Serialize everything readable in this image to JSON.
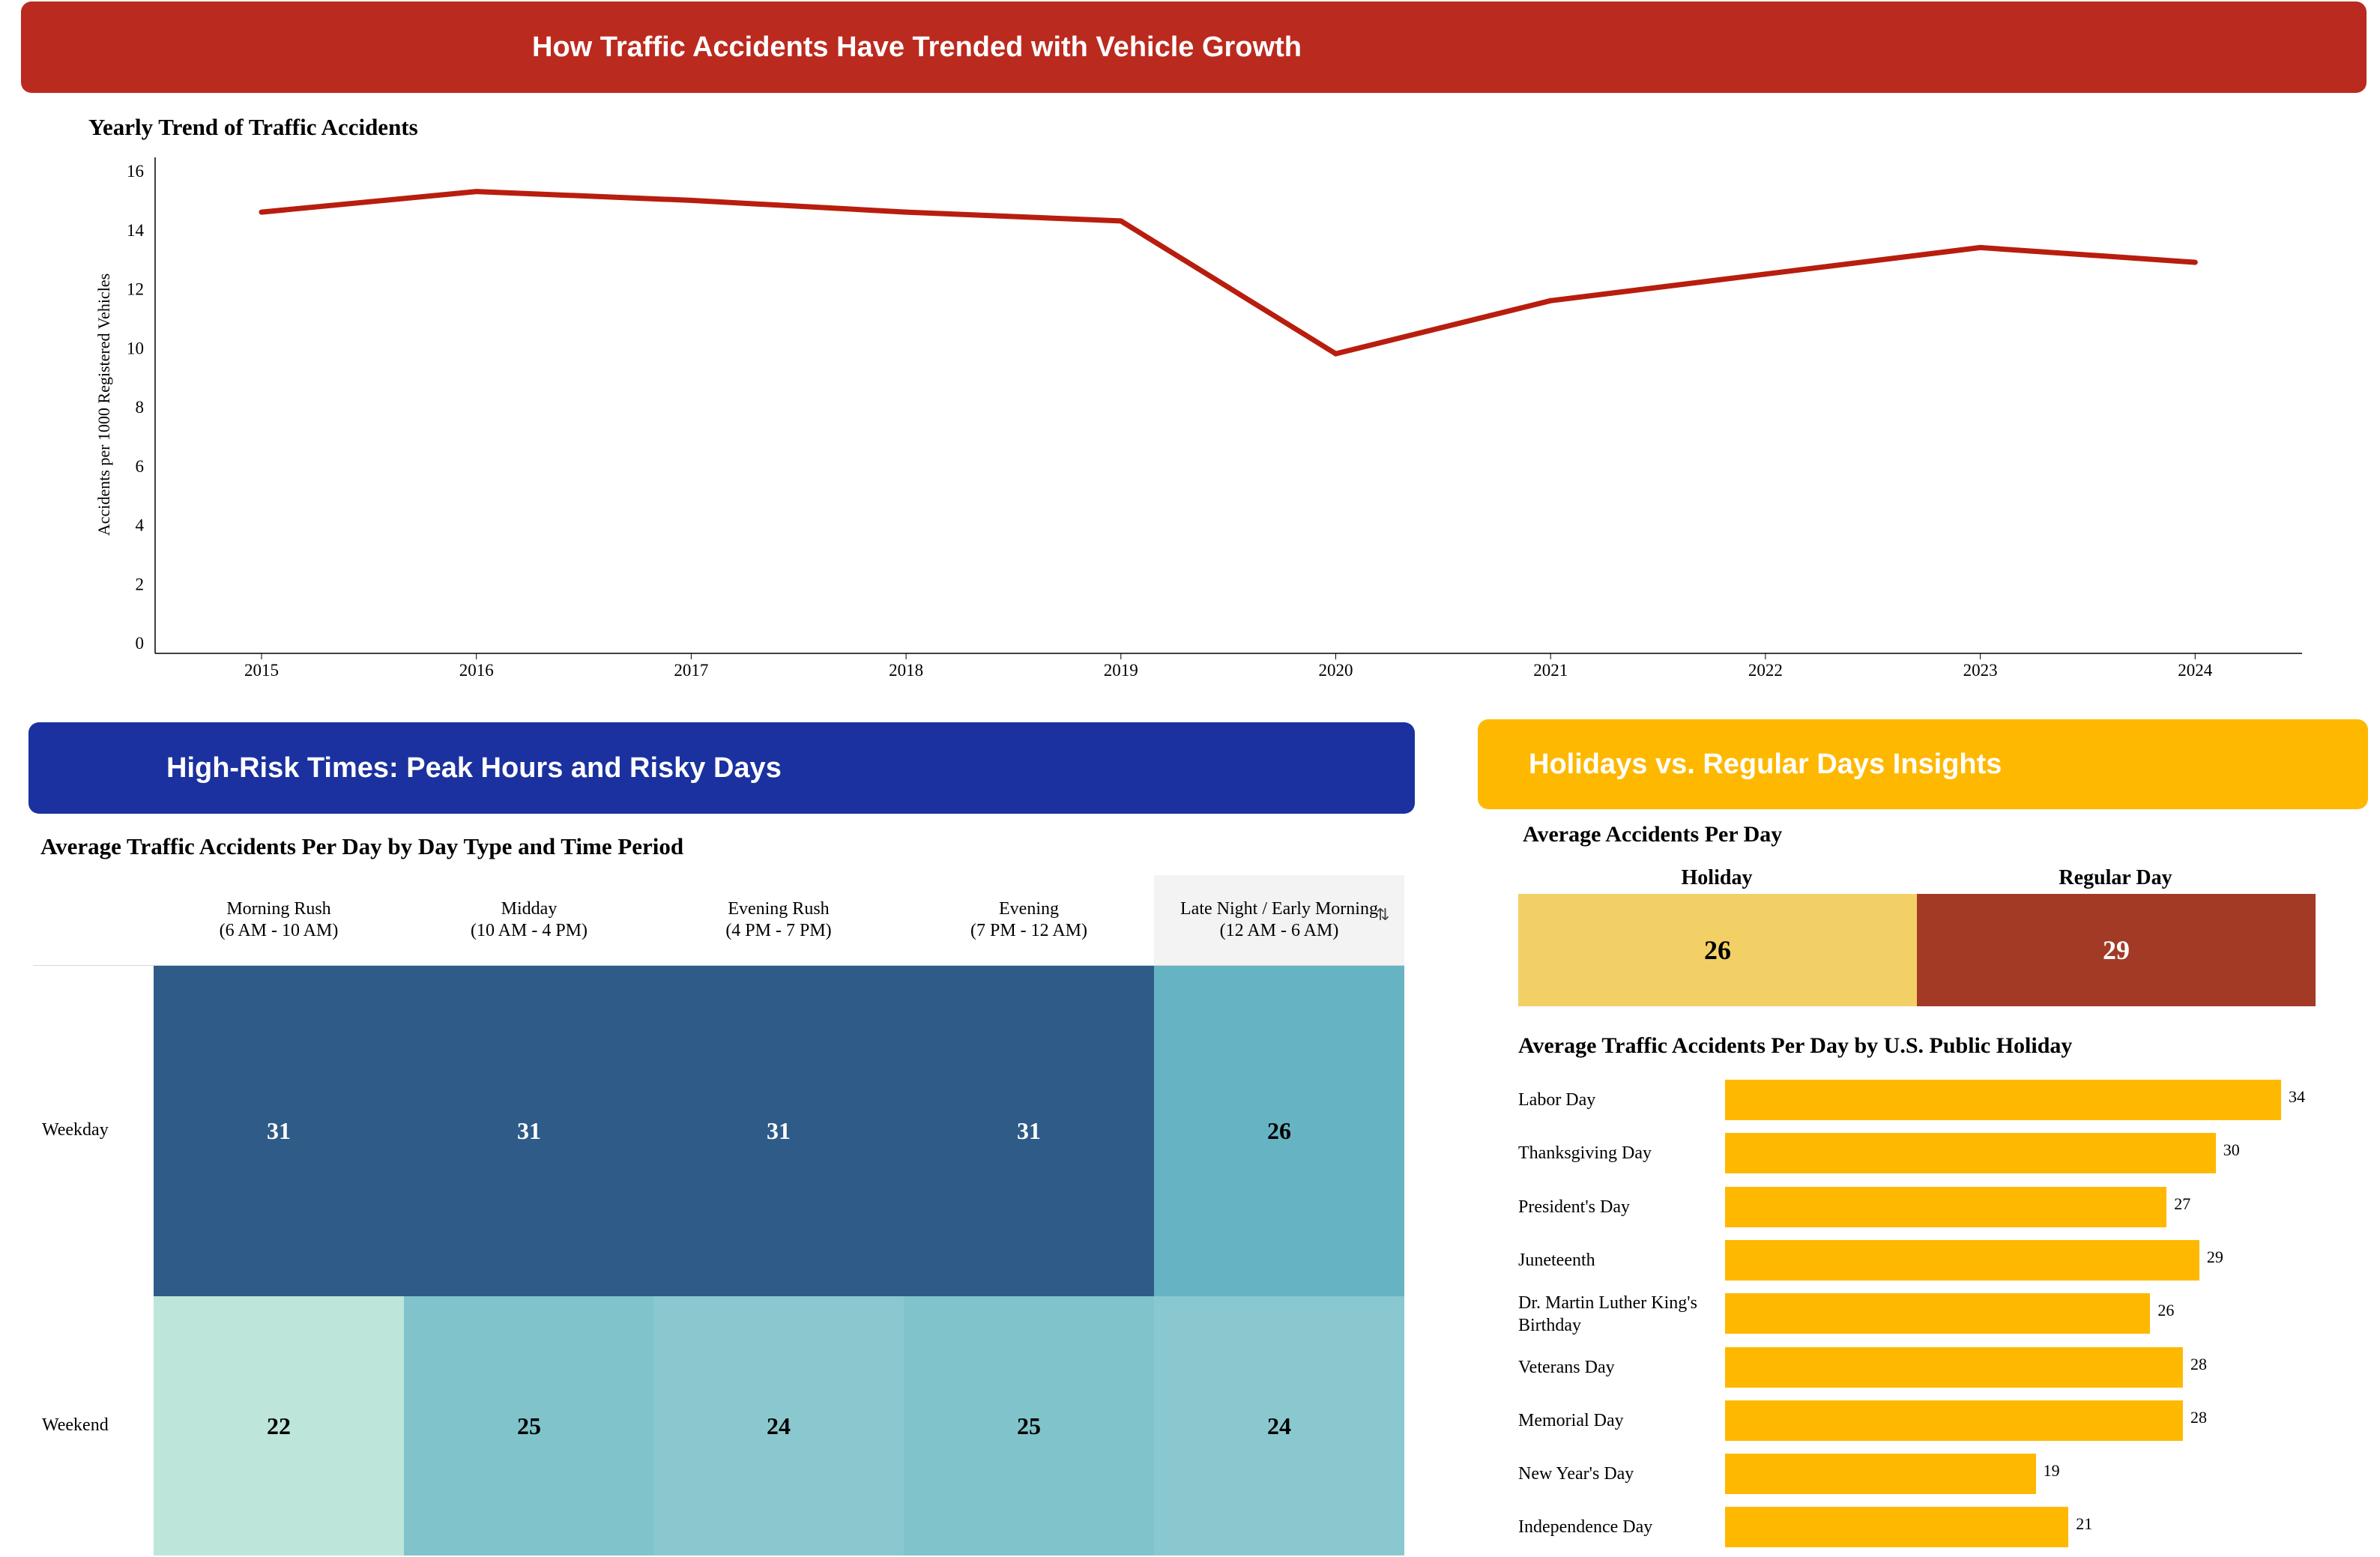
{
  "banners": {
    "top": "How Traffic Accidents Have Trended with Vehicle Growth",
    "blue": "High-Risk Times: Peak Hours and Risky Days",
    "yellow": "Holidays vs. Regular Days Insights"
  },
  "colors": {
    "red_banner": "#bb2a1f",
    "blue_banner": "#1b319f",
    "yellow_banner": "#ffb800",
    "line": "#b81d0e",
    "holiday": "#f2d066",
    "regular_day": "#a23a25",
    "bar": "#ffb800"
  },
  "chart_data": [
    {
      "type": "line",
      "title": "Yearly Trend of Traffic Accidents",
      "xlabel": "",
      "ylabel": "Accidents per 1000 Registered Vehicles",
      "x": [
        "2015",
        "2016",
        "2017",
        "2018",
        "2019",
        "2020",
        "2021",
        "2022",
        "2023",
        "2024"
      ],
      "series": [
        {
          "values": [
            14.6,
            15.3,
            15.0,
            14.6,
            14.3,
            9.8,
            11.6,
            12.5,
            13.4,
            12.9
          ]
        }
      ],
      "yticks": [
        0,
        2,
        4,
        6,
        8,
        10,
        12,
        14,
        16
      ],
      "ylim": [
        0,
        16
      ],
      "grid": false
    },
    {
      "type": "heatmap",
      "title": "Average Traffic Accidents Per Day by Day Type and Time Period",
      "columns": [
        {
          "line1": "Morning Rush",
          "line2": "(6 AM - 10 AM)"
        },
        {
          "line1": "Midday",
          "line2": "(10 AM - 4 PM)"
        },
        {
          "line1": "Evening Rush",
          "line2": "(4 PM - 7 PM)"
        },
        {
          "line1": "Evening",
          "line2": "(7 PM - 12 AM)"
        },
        {
          "line1": "Late Night / Early Morning",
          "line2": "(12 AM - 6 AM)"
        }
      ],
      "rows": [
        {
          "label": "Weekday",
          "values": [
            31,
            31,
            31,
            31,
            26
          ],
          "colors": [
            "#2e5b87",
            "#2e5b87",
            "#2e5b87",
            "#2e5b87",
            "#66b3c3"
          ]
        },
        {
          "label": "Weekend",
          "values": [
            22,
            25,
            24,
            25,
            24
          ],
          "colors": [
            "#bde5da",
            "#80c3cb",
            "#8ac8cf",
            "#80c3cb",
            "#8ac8cf"
          ]
        }
      ]
    },
    {
      "type": "table",
      "title": "Average Accidents Per Day",
      "categories": [
        "Holiday",
        "Regular Day"
      ],
      "values": [
        26,
        29
      ]
    },
    {
      "type": "bar",
      "orientation": "horizontal",
      "title": "Average Traffic Accidents Per Day by U.S. Public Holiday",
      "categories": [
        "Labor Day",
        "Thanksgiving Day",
        "President's Day",
        "Juneteenth",
        "Dr. Martin Luther King's Birthday",
        "Veterans Day",
        "Memorial Day",
        "New Year's Day",
        "Independence Day"
      ],
      "values": [
        34,
        30,
        27,
        29,
        26,
        28,
        28,
        19,
        21
      ],
      "xlim": [
        0,
        34
      ]
    }
  ]
}
